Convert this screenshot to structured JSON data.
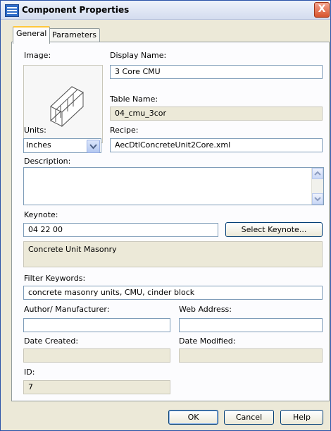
{
  "window": {
    "title": "Component Properties",
    "close_label": "X"
  },
  "tabs": [
    {
      "label": "General",
      "active": true
    },
    {
      "label": "Parameters",
      "active": false
    }
  ],
  "general": {
    "image_label": "Image:",
    "display_name_label": "Display Name:",
    "display_name_value": "3 Core CMU",
    "table_name_label": "Table Name:",
    "table_name_value": "04_cmu_3cor",
    "units_label": "Units:",
    "units_value": "Inches",
    "recipe_label": "Recipe:",
    "recipe_value": "AecDtlConcreteUnit2Core.xml",
    "description_label": "Description:",
    "description_value": "",
    "keynote_label": "Keynote:",
    "keynote_value": "04 22 00",
    "select_keynote_label": "Select Keynote...",
    "keynote_text": "Concrete Unit Masonry",
    "filter_keywords_label": "Filter Keywords:",
    "filter_keywords_value": "concrete masonry units, CMU, cinder block",
    "author_label": "Author/ Manufacturer:",
    "author_value": "",
    "web_address_label": "Web Address:",
    "web_address_value": "",
    "date_created_label": "Date Created:",
    "date_created_value": "",
    "date_modified_label": "Date Modified:",
    "date_modified_value": "",
    "id_label": "ID:",
    "id_value": "7"
  },
  "buttons": {
    "ok": "OK",
    "cancel": "Cancel",
    "help": "Help"
  },
  "colors": {
    "title_border": "#2a52a8",
    "dialog_bg": "#ece9d8",
    "tab_highlight": "#ffc73c",
    "close_red": "#d8532c"
  },
  "icons": {
    "app": "component-properties-icon",
    "close": "close-icon",
    "image": "cmu-block-image",
    "dropdown": "chevron-down-icon"
  }
}
